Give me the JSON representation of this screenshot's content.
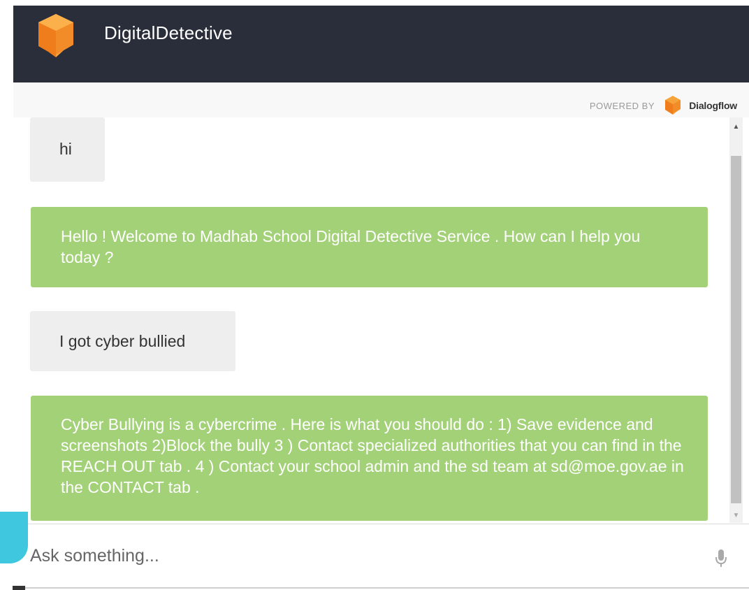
{
  "header": {
    "title": "DigitalDetective",
    "logo_icon": "cube-logo-icon",
    "brand_color": "#f28c28",
    "background_color": "#2a2e3b"
  },
  "powered_by": {
    "label": "POWERED BY",
    "brand": "Dialogflow",
    "brand_icon": "dialogflow-logo-icon"
  },
  "messages": [
    {
      "from": "user",
      "text": "hi"
    },
    {
      "from": "bot",
      "text": "Hello ! Welcome to Madhab School Digital Detective Service . How can I help you today ?"
    },
    {
      "from": "user",
      "text": "I got cyber bullied"
    },
    {
      "from": "bot",
      "text": "Cyber Bullying is a cybercrime . Here is what you should do : 1) Save evidence and screenshots 2)Block the bully 3 ) Contact specialized authorities that you can find in the REACH OUT tab . 4 ) Contact your school admin and the sd team at sd@moe.gov.ae in the CONTACT tab ."
    }
  ],
  "colors": {
    "bot_bubble": "#a3d178",
    "user_bubble": "#eeeeee"
  },
  "input": {
    "placeholder": "Ask something...",
    "value": "",
    "mic_icon": "microphone-icon"
  }
}
